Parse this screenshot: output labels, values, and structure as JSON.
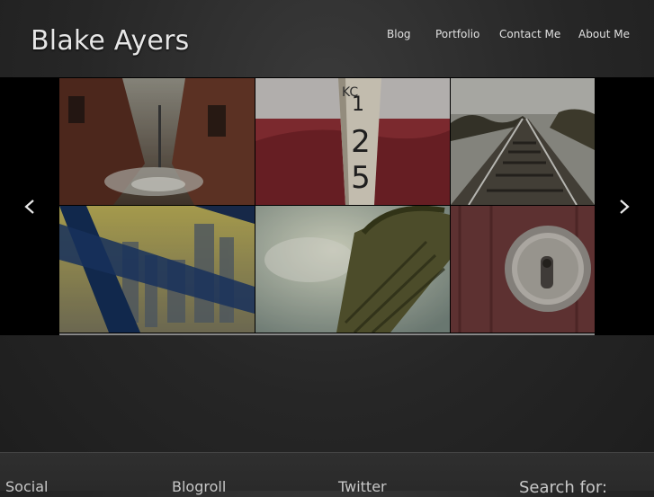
{
  "site": {
    "title": "Blake Ayers"
  },
  "nav": {
    "items": [
      {
        "label": "Blog"
      },
      {
        "label": "Portfolio"
      },
      {
        "label": "Contact Me"
      },
      {
        "label": "About Me"
      }
    ]
  },
  "slider": {
    "prev_icon": "chevron-left-icon",
    "next_icon": "chevron-right-icon",
    "photos": [
      {
        "subject": "alley-with-puddle"
      },
      {
        "subject": "kc-125-post"
      },
      {
        "subject": "railroad-tracks"
      },
      {
        "subject": "city-skyline-through-frame"
      },
      {
        "subject": "palm-tree-sky"
      },
      {
        "subject": "deadbolt-lock"
      }
    ]
  },
  "footer": {
    "widgets": [
      {
        "title": "Social"
      },
      {
        "title": "Blogroll"
      },
      {
        "title": "Twitter"
      },
      {
        "title": "Search for:"
      }
    ]
  },
  "colors": {
    "background": "#262626",
    "slider_bg": "#000000",
    "text": "#e0e0e0"
  }
}
